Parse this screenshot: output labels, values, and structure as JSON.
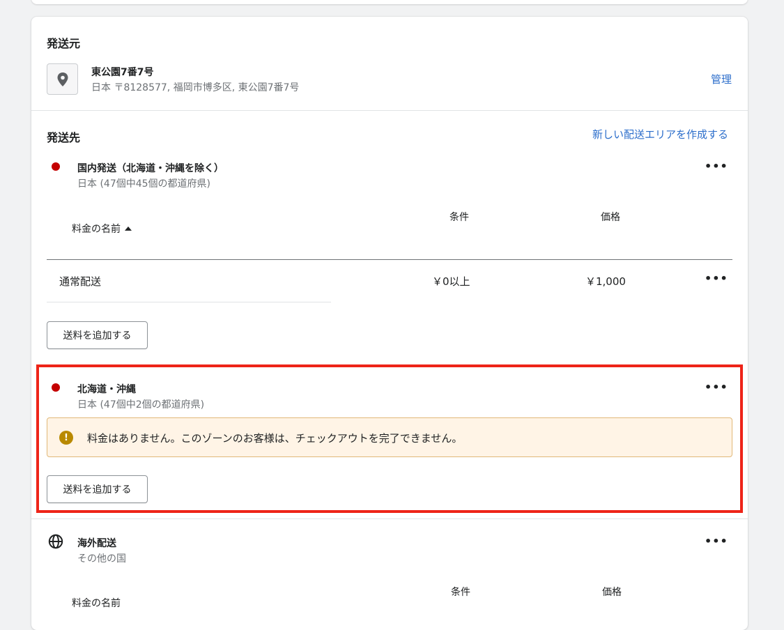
{
  "origin": {
    "heading": "発送元",
    "address_name": "東公園7番7号",
    "address_detail": "日本 〒8128577, 福岡市博多区, 東公園7番7号",
    "manage_link": "管理"
  },
  "destination": {
    "heading": "発送先",
    "create_zone_link": "新しい配送エリアを作成する"
  },
  "zones": [
    {
      "name": "国内発送（北海道・沖縄を除く）",
      "subtitle": "日本 (47個中45個の都道府県)",
      "indicator": "red-dot",
      "table": {
        "headers": {
          "name": "料金の名前",
          "condition": "条件",
          "price": "価格"
        },
        "rows": [
          {
            "name": "通常配送",
            "condition": "￥0以上",
            "price": "￥1,000"
          }
        ]
      },
      "add_button": "送料を追加する"
    },
    {
      "name": "北海道・沖縄",
      "subtitle": "日本 (47個中2個の都道府県)",
      "indicator": "red-dot",
      "warning": "料金はありません。このゾーンのお客様は、チェックアウトを完了できません。",
      "add_button": "送料を追加する"
    },
    {
      "name": "海外配送",
      "subtitle": "その他の国",
      "indicator": "globe-icon",
      "table": {
        "headers": {
          "name": "料金の名前",
          "condition": "条件",
          "price": "価格"
        }
      }
    }
  ],
  "more_label": "•••",
  "colors": {
    "link": "#2c6ecb",
    "red_dot": "#c40000",
    "highlight": "#ee2418",
    "warning_bg": "#fff4e6",
    "warning_icon": "#b98900"
  }
}
